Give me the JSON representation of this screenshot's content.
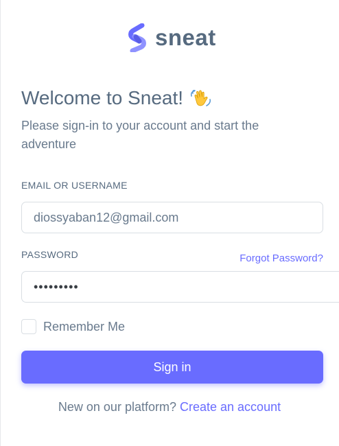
{
  "brand": {
    "name": "sneat",
    "logo_icon": "sneat-logo-icon",
    "accent_color": "#696cff"
  },
  "welcome": {
    "title": "Welcome to Sneat!",
    "icon": "waving-hand-icon",
    "subtitle": "Please sign-in to your account and start the adventure"
  },
  "form": {
    "email_label": "EMAIL OR USERNAME",
    "email_value": "diossyaban12@gmail.com",
    "password_label": "PASSWORD",
    "password_value": "•••••••••",
    "forgot_link": "Forgot Password?",
    "remember_label": "Remember Me",
    "remember_checked": false,
    "signin_button": "Sign in"
  },
  "footer": {
    "prompt": "New on our platform?",
    "create_link": "Create an account"
  }
}
